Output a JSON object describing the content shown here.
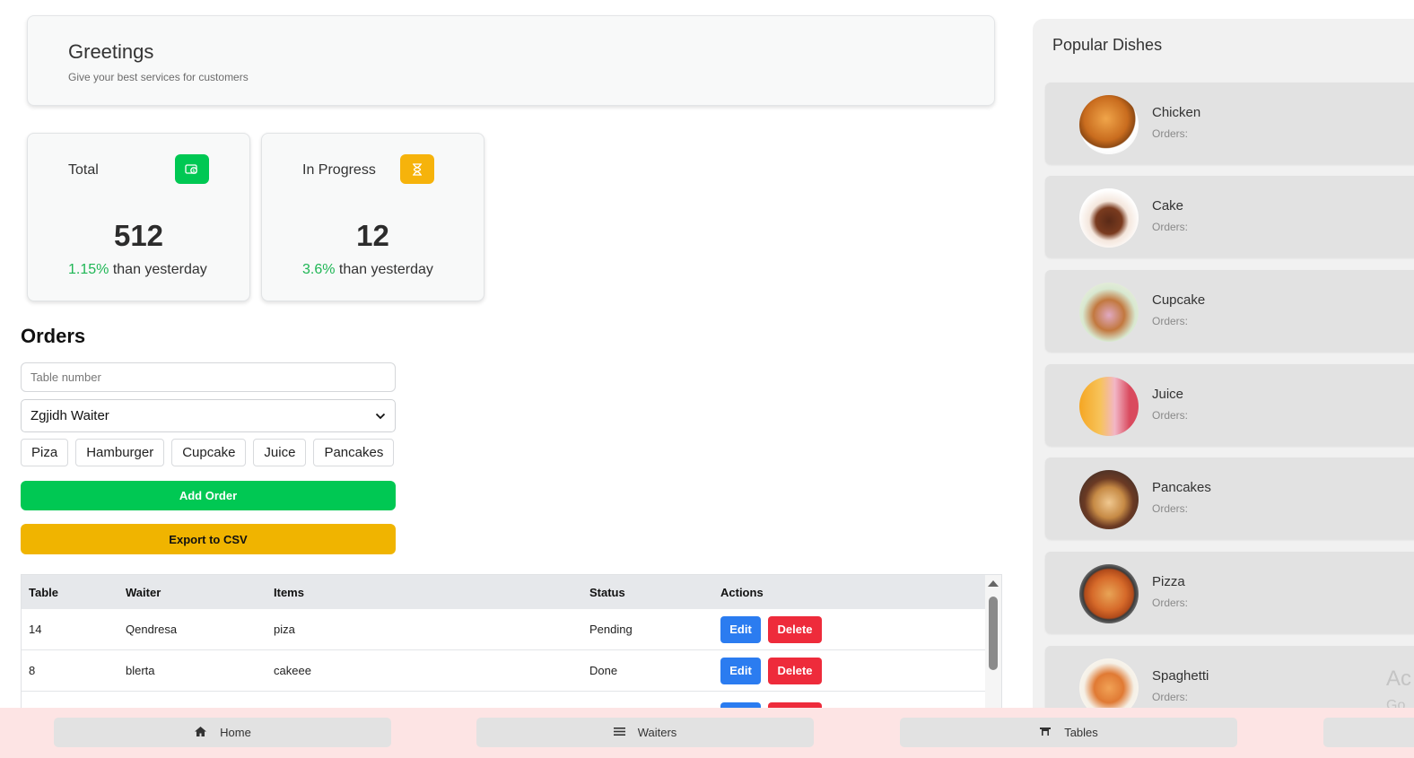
{
  "greeting": {
    "title": "Greetings",
    "subtitle": "Give your best services for customers"
  },
  "stats": [
    {
      "label": "Total",
      "value": "512",
      "change": "1.15%",
      "change_suffix": " than yesterday",
      "icon": "money-icon",
      "icon_color": "#00c853"
    },
    {
      "label": "In Progress",
      "value": "12",
      "change": "3.6%",
      "change_suffix": " than yesterday",
      "icon": "hourglass-icon",
      "icon_color": "#f6b30b"
    }
  ],
  "orders": {
    "title": "Orders",
    "table_placeholder": "Table number",
    "waiter_selected": "Zgjidh Waiter",
    "items": [
      "Piza",
      "Hamburger",
      "Cupcake",
      "Juice",
      "Pancakes"
    ],
    "add_label": "Add Order",
    "export_label": "Export to CSV",
    "columns": [
      "Table",
      "Waiter",
      "Items",
      "Status",
      "Actions"
    ],
    "rows": [
      {
        "table": "14",
        "waiter": "Qendresa",
        "items": "piza",
        "status": "Pending"
      },
      {
        "table": "8",
        "waiter": "blerta",
        "items": "cakeee",
        "status": "Done"
      }
    ],
    "edit_label": "Edit",
    "delete_label": "Delete"
  },
  "popular": {
    "title": "Popular Dishes",
    "orders_label": "Orders:",
    "dishes": [
      "Chicken",
      "Cake",
      "Cupcake",
      "Juice",
      "Pancakes",
      "Pizza",
      "Spaghetti"
    ]
  },
  "watermark": {
    "line1": "Ac",
    "line2": "Go"
  },
  "nav": [
    "Home",
    "Waiters",
    "Tables"
  ],
  "colors": {
    "green": "#00c853",
    "yellow": "#f0b400",
    "blue": "#2b7cf0",
    "red": "#ee2b3b",
    "nav_bg": "#fde4e4"
  }
}
